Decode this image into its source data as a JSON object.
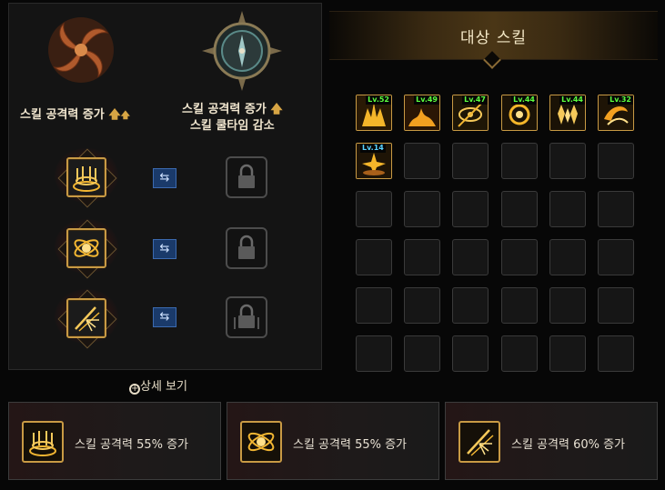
{
  "left": {
    "header1_text": "스킬 공격력 증가",
    "header2_line1": "스킬 공격력 증가",
    "header2_line2": "스킬 쿨타임 감소",
    "swap_glyph": "⇆"
  },
  "detail_link": "상세 보기",
  "target": {
    "title": "대상 스킬",
    "skills": [
      {
        "level": "Lv.52",
        "icon": "flame-burst-icon"
      },
      {
        "level": "Lv.49",
        "icon": "fire-wave-icon"
      },
      {
        "level": "Lv.47",
        "icon": "eye-slash-icon"
      },
      {
        "level": "Lv.44",
        "icon": "ring-blast-icon"
      },
      {
        "level": "Lv.44",
        "icon": "crystal-shards-icon"
      },
      {
        "level": "Lv.32",
        "icon": "storm-swirl-icon"
      },
      {
        "level": "Lv.14",
        "icon": "explosion-icon"
      }
    ]
  },
  "cards": [
    {
      "text": "스킬 공격력 55% 증가",
      "icon": "golden-altar-icon"
    },
    {
      "text": "스킬 공격력 55% 증가",
      "icon": "orbit-atom-icon"
    },
    {
      "text": "스킬 공격력 60% 증가",
      "icon": "slash-burst-icon"
    }
  ],
  "colors": {
    "gold": "#c89a44",
    "level_green": "#5cff3e",
    "level_blue": "#5ad2ff",
    "swap_blue": "#1a3a6a"
  }
}
